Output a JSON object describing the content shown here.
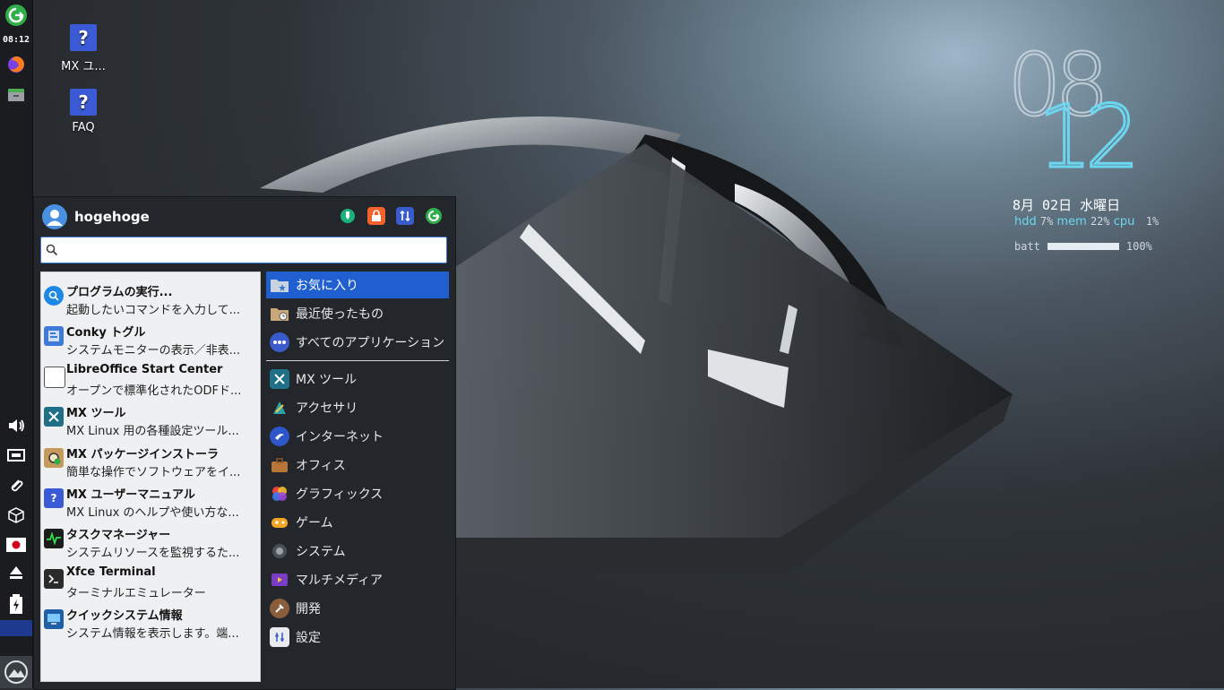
{
  "panel": {
    "clock": "08:12"
  },
  "desktop": {
    "icons": [
      {
        "label": "MX ユ..."
      },
      {
        "label": "FAQ"
      }
    ]
  },
  "conky": {
    "hour": "08",
    "minute": "12",
    "date": "8月 02日 水曜日",
    "hdd_label": "hdd",
    "hdd_value": "7%",
    "mem_label": "mem",
    "mem_value": "22%",
    "cpu_label": "cpu",
    "cpu_value": "1%",
    "batt_label": "batt",
    "batt_value": "100%",
    "batt_level": 1.0
  },
  "menu": {
    "username": "hogehoge",
    "search": {
      "value": "",
      "placeholder": ""
    },
    "favorites": [
      {
        "title": "プログラムの実行...",
        "desc": "起動したいコマンドを入力して..."
      },
      {
        "title": "Conky トグル",
        "desc": "システムモニターの表示／非表..."
      },
      {
        "title": "LibreOffice Start Center",
        "desc": "オープンで標準化されたODFド..."
      },
      {
        "title": "MX ツール",
        "desc": "MX Linux 用の各種設定ツール..."
      },
      {
        "title": "MX パッケージインストーラ",
        "desc": "簡単な操作でソフトウェアをイ..."
      },
      {
        "title": "MX ユーザーマニュアル",
        "desc": "MX Linux のヘルプや使い方な..."
      },
      {
        "title": "タスクマネージャー",
        "desc": "システムリソースを監視するた..."
      },
      {
        "title": "Xfce Terminal",
        "desc": "ターミナルエミュレーター"
      },
      {
        "title": "クイックシステム情報",
        "desc": "システム情報を表示します。端..."
      }
    ],
    "categories_top": [
      {
        "label": "お気に入り"
      },
      {
        "label": "最近使ったもの"
      },
      {
        "label": "すべてのアプリケーション"
      }
    ],
    "categories": [
      {
        "label": "MX ツール"
      },
      {
        "label": "アクセサリ"
      },
      {
        "label": "インターネット"
      },
      {
        "label": "オフィス"
      },
      {
        "label": "グラフィックス"
      },
      {
        "label": "ゲーム"
      },
      {
        "label": "システム"
      },
      {
        "label": "マルチメディア"
      },
      {
        "label": "開発"
      },
      {
        "label": "設定"
      }
    ]
  },
  "colors": {
    "accent": "#1f5fcf",
    "conky_cyan": "#6cd6f0"
  }
}
